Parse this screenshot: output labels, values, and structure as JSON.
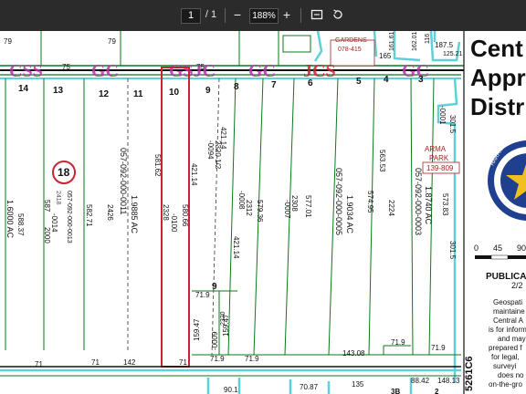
{
  "toolbar": {
    "page_current": "1",
    "page_separator": "/",
    "page_total": "1",
    "zoom_out_label": "−",
    "zoom_level": "188%",
    "zoom_in_label": "+",
    "icons": [
      "zoom-out-icon",
      "zoom-in-icon",
      "fit-page-icon",
      "rotate-icon"
    ]
  },
  "map": {
    "top_numbers": [
      "79",
      "75",
      "79",
      "75",
      "165",
      "161.61",
      "187.5",
      "125.21",
      "162.01",
      "116"
    ],
    "top_label": "GARDENS",
    "top_ref": "078-415",
    "lot_numbers": [
      "14",
      "13",
      "12",
      "11",
      "10",
      "9",
      "8",
      "7",
      "6",
      "5",
      "4",
      "3"
    ],
    "block_marker": "18",
    "lot_dims": [
      "587",
      "588.37",
      "582.71",
      "581.62",
      "580.66",
      "421.14",
      "579.36",
      "577.01",
      "574.95",
      "563.53",
      "573.83",
      "421.14",
      "301.5",
      "159.47",
      "71.9",
      "71.9",
      "71.9",
      "143.08",
      "71.9",
      "71.9",
      "71",
      "142",
      "71",
      "71",
      "159.47",
      "421.14",
      "301.5"
    ],
    "acct_codes": [
      "057-092-000-0011",
      "057-092-000-0013",
      "057-092-000-0005",
      "057-092-000-0003"
    ],
    "acres": [
      "1.6000 AC",
      "1.9885 AC",
      "1.9034 AC",
      "1.8740 AC"
    ],
    "sub_codes": [
      "-0014",
      "2418",
      "2000",
      "2426",
      "2328",
      "-0100",
      "-0094",
      "2320 1/2",
      "-0008",
      "2312",
      "-0007",
      "2308",
      "2224",
      "-0001",
      "2320",
      "-0009"
    ],
    "inner_nine": "9",
    "arma_park": [
      "ARMA",
      "PARK"
    ],
    "arma_ref": "139-809",
    "sidebar_title": [
      "Cent",
      "Appr",
      "Distr"
    ],
    "seal_text": "HARRIS CENTRAL APPRAISAL",
    "scale_ticks": [
      "0",
      "45",
      "90"
    ],
    "publication": "PUBLICA",
    "publication_date": "2/2",
    "disclaimer": [
      "Geospati",
      "maintaine",
      "Central A",
      "is for inform",
      "and may",
      "prepared f",
      "for legal,",
      "surveyi",
      "does no",
      "on-the-gro"
    ],
    "map_id": "5261C6",
    "bottom_numbers": [
      "90.1",
      "70.87",
      "135",
      "88.42",
      "148.13",
      "3B",
      "2"
    ]
  }
}
